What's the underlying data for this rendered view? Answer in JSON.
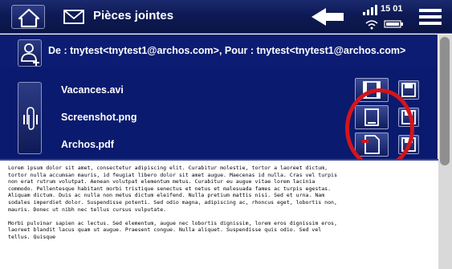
{
  "topbar": {
    "title": "Pièces jointes",
    "time": "15 01"
  },
  "header": {
    "from_to": "De : tnytest<tnytest1@archos.com>, Pour : tnytest<tnytest1@archos.com>"
  },
  "attachments": [
    {
      "name": "Vacances.avi",
      "type_icon": "film-icon"
    },
    {
      "name": "Screenshot.png",
      "type_icon": "image-icon"
    },
    {
      "name": "Archos.pdf",
      "type_icon": "pdf-icon"
    }
  ],
  "body": {
    "paragraphs": [
      "Lorem ipsum dolor sit amet, consectetur adipiscing elit. Curabitur molestie, tortor a laoreet dictum, tortor nulla accumsan mauris, id feugiat libero dolor sit amet augue. Maecenas id nulla. Cras vel turpis non erat rutrum volutpat. Aenean volutpat elementum metus. Curabitur eu augue vitae lorem lacinia commodo. Pellentesque habitant morbi tristique senectus et netus et malesuada fames ac turpis egestas. Aliquam dictum. Duis ac nulla non metus dictum eleifend. Nulla pretium mattis nisi. Sed et urna. Nam sodales imperdiet dolor. Suspendisse potenti. Sed odio magna, adipiscing ac, rhoncus eget, lobortis non, mauris. Donec ut nibh nec tellus cursus vulputate.",
      "Morbi pulvinar sapien ac lectus. Sed elementum, augue nec lobortis dignissim, lorem eros dignissim eros, laoreet blandit lacus quam ut augue. Praesent congue. Nulla aliquet. Suspendisse quis odio. Sed vel tellus. Quisque"
    ]
  },
  "colors": {
    "panel_bg": "#0a1a6e",
    "highlight": "#d4141b"
  }
}
